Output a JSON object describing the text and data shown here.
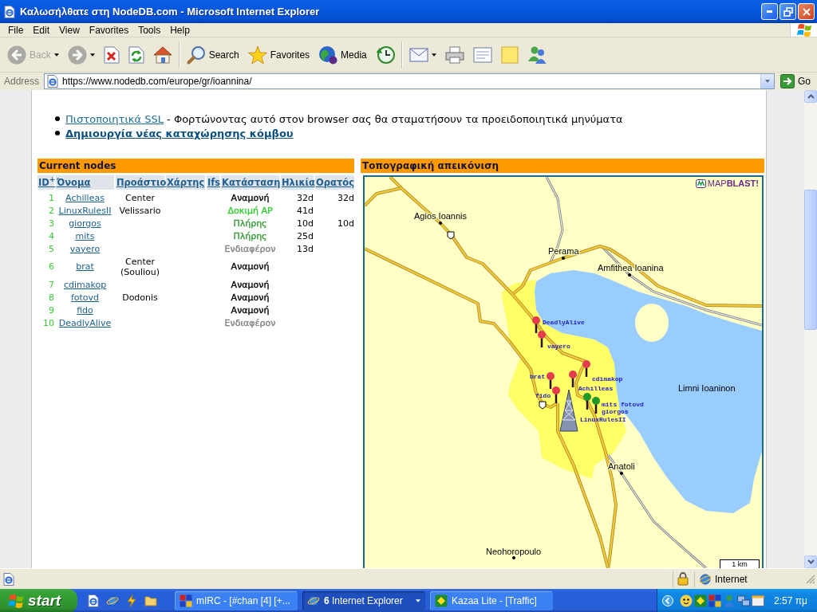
{
  "window": {
    "title": "Καλωσήλθατε στη NodeDB.com - Microsoft Internet Explorer"
  },
  "menu": [
    "File",
    "Edit",
    "View",
    "Favorites",
    "Tools",
    "Help"
  ],
  "toolbar": [
    [
      {
        "kind": "back",
        "label": "Back",
        "disabled": true,
        "dropdown": true
      },
      {
        "kind": "forward",
        "disabled": true,
        "dropdown": true
      },
      {
        "kind": "stop",
        "disabled": false,
        "dropdown": false
      },
      {
        "kind": "refresh",
        "disabled": false,
        "dropdown": false
      },
      {
        "kind": "home",
        "disabled": false,
        "dropdown": false
      }
    ],
    [
      {
        "kind": "search",
        "label": "Search",
        "disabled": false,
        "dropdown": false
      },
      {
        "kind": "favorites",
        "label": "Favorites",
        "disabled": false,
        "dropdown": false
      },
      {
        "kind": "media",
        "label": "Media",
        "disabled": false,
        "dropdown": false
      },
      {
        "kind": "history",
        "disabled": false,
        "dropdown": false
      }
    ],
    [
      {
        "kind": "mail",
        "disabled": false,
        "dropdown": true
      },
      {
        "kind": "print",
        "disabled": false,
        "dropdown": false
      },
      {
        "kind": "edit",
        "disabled": false,
        "dropdown": false
      },
      {
        "kind": "discuss",
        "disabled": false,
        "dropdown": false
      },
      {
        "kind": "messenger",
        "disabled": false,
        "dropdown": false
      }
    ]
  ],
  "address": {
    "label": "Address",
    "url": "https://www.nodedb.com/europe/gr/ioannina/",
    "go": "Go"
  },
  "page": {
    "links": [
      {
        "link": "Πιστοποιητικά SSL",
        "text": " - Φορτώνοντας αυτό στον browser σας θα σταματήσουν τα προειδοποιητικά μηνύματα",
        "bold": false
      },
      {
        "link": "Δημιουργία νέας καταχώρησης κόμβου",
        "bold": true
      }
    ],
    "nodes_panel": {
      "title": "Current nodes",
      "columns": [
        "ID$^{+}$",
        "Όνομα",
        "Προάστιο",
        "Χάρτης",
        "Ifs",
        "Κατάσταση",
        "Ηλικία",
        "Ορατός"
      ],
      "rows": [
        {
          "id": "1",
          "name": "Achilleas",
          "area": "Center",
          "status": {
            "text": "Αναμονή",
            "color": "#000000"
          },
          "age": "32d",
          "seen": "32d"
        },
        {
          "id": "2",
          "name": "LinuxRulesII",
          "area": "Velissario",
          "status": {
            "text": "Δοκιμή AP",
            "color": "#33cc33"
          },
          "age": "41d"
        },
        {
          "id": "3",
          "name": "giorgos",
          "status": {
            "text": "Πλήρης",
            "color": "#339933"
          },
          "age": "10d",
          "seen": "10d"
        },
        {
          "id": "4",
          "name": "mits",
          "status": {
            "text": "Πλήρης",
            "color": "#339933"
          },
          "age": "25d"
        },
        {
          "id": "5",
          "name": "vayero",
          "status": {
            "text": "Ενδιαφέρον",
            "color": "#808080"
          },
          "age": "13d"
        },
        {
          "id": "6",
          "name": "brat",
          "area": "Center (Souliou)",
          "status": {
            "text": "Αναμονή",
            "color": "#000000"
          }
        },
        {
          "id": "7",
          "name": "cdimakop",
          "status": {
            "text": "Αναμονή",
            "color": "#000000"
          }
        },
        {
          "id": "8",
          "name": "fotovd",
          "area": "Dodonis",
          "status": {
            "text": "Αναμονή",
            "color": "#000000"
          }
        },
        {
          "id": "9",
          "name": "fido",
          "status": {
            "text": "Αναμονή",
            "color": "#000000"
          }
        },
        {
          "id": "10",
          "name": "DeadlyAlive",
          "status": {
            "text": "Ενδιαφέρον",
            "color": "#808080"
          }
        }
      ]
    },
    "map_panel": {
      "title": "Τοπογραφική απεικόνιση",
      "logo": "MAP**BLAST!**",
      "places": [
        {
          "name": "Agios Ioannis",
          "kind": "town"
        },
        {
          "name": "Perama",
          "kind": "town"
        },
        {
          "name": "Amfithea Ioanina",
          "kind": "town"
        },
        {
          "name": "Limni Ioaninon",
          "kind": "lake"
        },
        {
          "name": "Anatoli",
          "kind": "town"
        },
        {
          "name": "Neohoropoulo",
          "kind": "town"
        }
      ],
      "markers": [
        {
          "label": "DeadlyAlive",
          "kind": "pin",
          "color": "#e63c50"
        },
        {
          "label": "vayero",
          "kind": "pin",
          "color": "#e63c50"
        },
        {
          "label": "brat",
          "kind": "pin",
          "color": "#e63c50"
        },
        {
          "label": "cdimakop",
          "kind": "pin",
          "color": "#e63c50"
        },
        {
          "label": "Achilleas",
          "kind": "pin",
          "color": "#e63c50"
        },
        {
          "label": "fido",
          "kind": "pin",
          "color": "#e63c50"
        },
        {
          "label": "mits",
          "kind": "pin",
          "color": "#1f9a2a"
        },
        {
          "label": "fotovd",
          "kind": "label"
        },
        {
          "label": "giorgos",
          "kind": "pin",
          "color": "#1f9a2a"
        },
        {
          "label": "LinuxRulesII",
          "kind": "tower"
        }
      ],
      "scale": "1 km"
    }
  },
  "status_bar": {
    "zone": "Internet"
  },
  "taskbar": {
    "start": "start",
    "tasks": [
      {
        "title": "mIRC - [#chan [4] [+...",
        "kind": "mirc",
        "selected": false,
        "dropdown": false
      },
      {
        "title": "**6** Internet Explorer",
        "kind": "ie",
        "selected": true,
        "dropdown": true
      },
      {
        "title": "Kazaa Lite - [Traffic]",
        "kind": "kazaa",
        "selected": false,
        "dropdown": false
      }
    ],
    "clock": "2:57 πμ"
  }
}
